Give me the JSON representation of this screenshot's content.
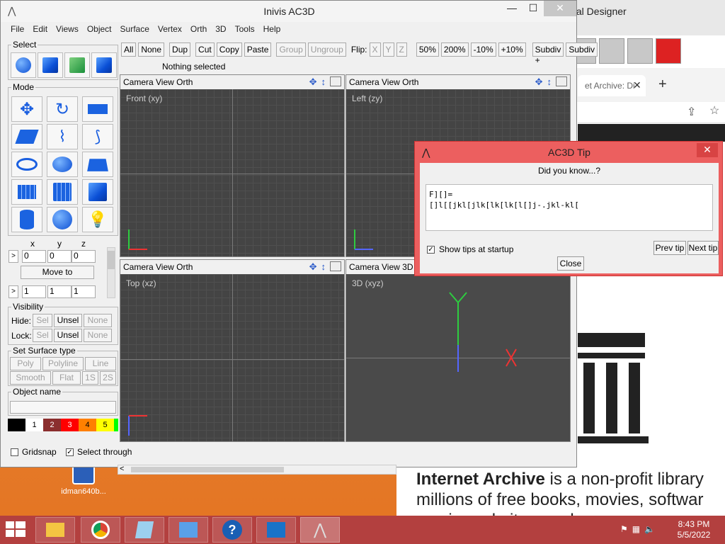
{
  "desktop": {
    "icon_label": "idman640b..."
  },
  "browser": {
    "window_title_fragment": "tal Designer",
    "tab_title": "et Archive: Di",
    "tab_close": "✕",
    "new_tab": "+",
    "page_text_bold": "Internet Archive",
    "page_text_rest": " is a non-profit library\nmillions of free books, movies, softwar\nmusic, websites, and more."
  },
  "ac3d": {
    "title": "Inivis AC3D",
    "menu": [
      "File",
      "Edit",
      "Views",
      "Object",
      "Surface",
      "Vertex",
      "Orth",
      "3D",
      "Tools",
      "Help"
    ],
    "toolbar": {
      "all": "All",
      "none": "None",
      "dup": "Dup",
      "cut": "Cut",
      "copy": "Copy",
      "paste": "Paste",
      "group": "Group",
      "ungroup": "Ungroup",
      "flip_label": "Flip:",
      "flip_x": "X",
      "flip_y": "Y",
      "flip_z": "Z",
      "z50": "50%",
      "z200": "200%",
      "zm10": "-10%",
      "zp10": "+10%",
      "subdiv_plus": "Subdiv +",
      "subdiv": "Subdiv"
    },
    "status": "Nothing selected",
    "left": {
      "select_title": "Select",
      "mode_title": "Mode",
      "x": "x",
      "y": "y",
      "z": "z",
      "pos_x": "0",
      "pos_y": "0",
      "pos_z": "0",
      "move_to": "Move to",
      "scale_x": "1",
      "scale_y": "1",
      "scale_z": "1",
      "arrow": ">",
      "visibility_title": "Visibility",
      "hide_label": "Hide:",
      "lock_label": "Lock:",
      "sel": "Sel",
      "unsel": "Unsel",
      "none": "None",
      "surface_title": "Set Surface type",
      "poly": "Poly",
      "polyline": "Polyline",
      "line": "Line",
      "smooth": "Smooth",
      "flat": "Flat",
      "s1": "1S",
      "s2": "2S",
      "object_name_title": "Object name",
      "object_name_value": "",
      "palette": [
        {
          "label": "",
          "color": "#000000"
        },
        {
          "label": "1",
          "color": "#ffffff"
        },
        {
          "label": "2",
          "color": "#8b2e2e"
        },
        {
          "label": "3",
          "color": "#ff0000"
        },
        {
          "label": "4",
          "color": "#ff8000"
        },
        {
          "label": "5",
          "color": "#ffff00"
        },
        {
          "label": "",
          "color": "#00ff00"
        }
      ]
    },
    "viewports": [
      {
        "header": "Camera  View  Orth",
        "label": "Front (xy)"
      },
      {
        "header": "Camera  View  Orth",
        "label": "Left (zy)"
      },
      {
        "header": "Camera  View  Orth",
        "label": "Top (xz)"
      },
      {
        "header": "Camera  View  3D",
        "label": "3D (xyz)"
      }
    ],
    "bottom": {
      "gridsnap": "Gridsnap",
      "select_through": "Select through"
    }
  },
  "dialog": {
    "title": "AC3D Tip",
    "close_x": "✕",
    "did_you_know": "Did you know...?",
    "tip_text": "F][]=\n[]l[[jkl[jlk[lk[lk[l[]j-.jkl-kl[",
    "show_tips": "Show tips at startup",
    "prev": "Prev tip",
    "next": "Next tip",
    "close": "Close"
  },
  "taskbar": {
    "time": "8:43 PM",
    "date": "5/5/2022"
  }
}
